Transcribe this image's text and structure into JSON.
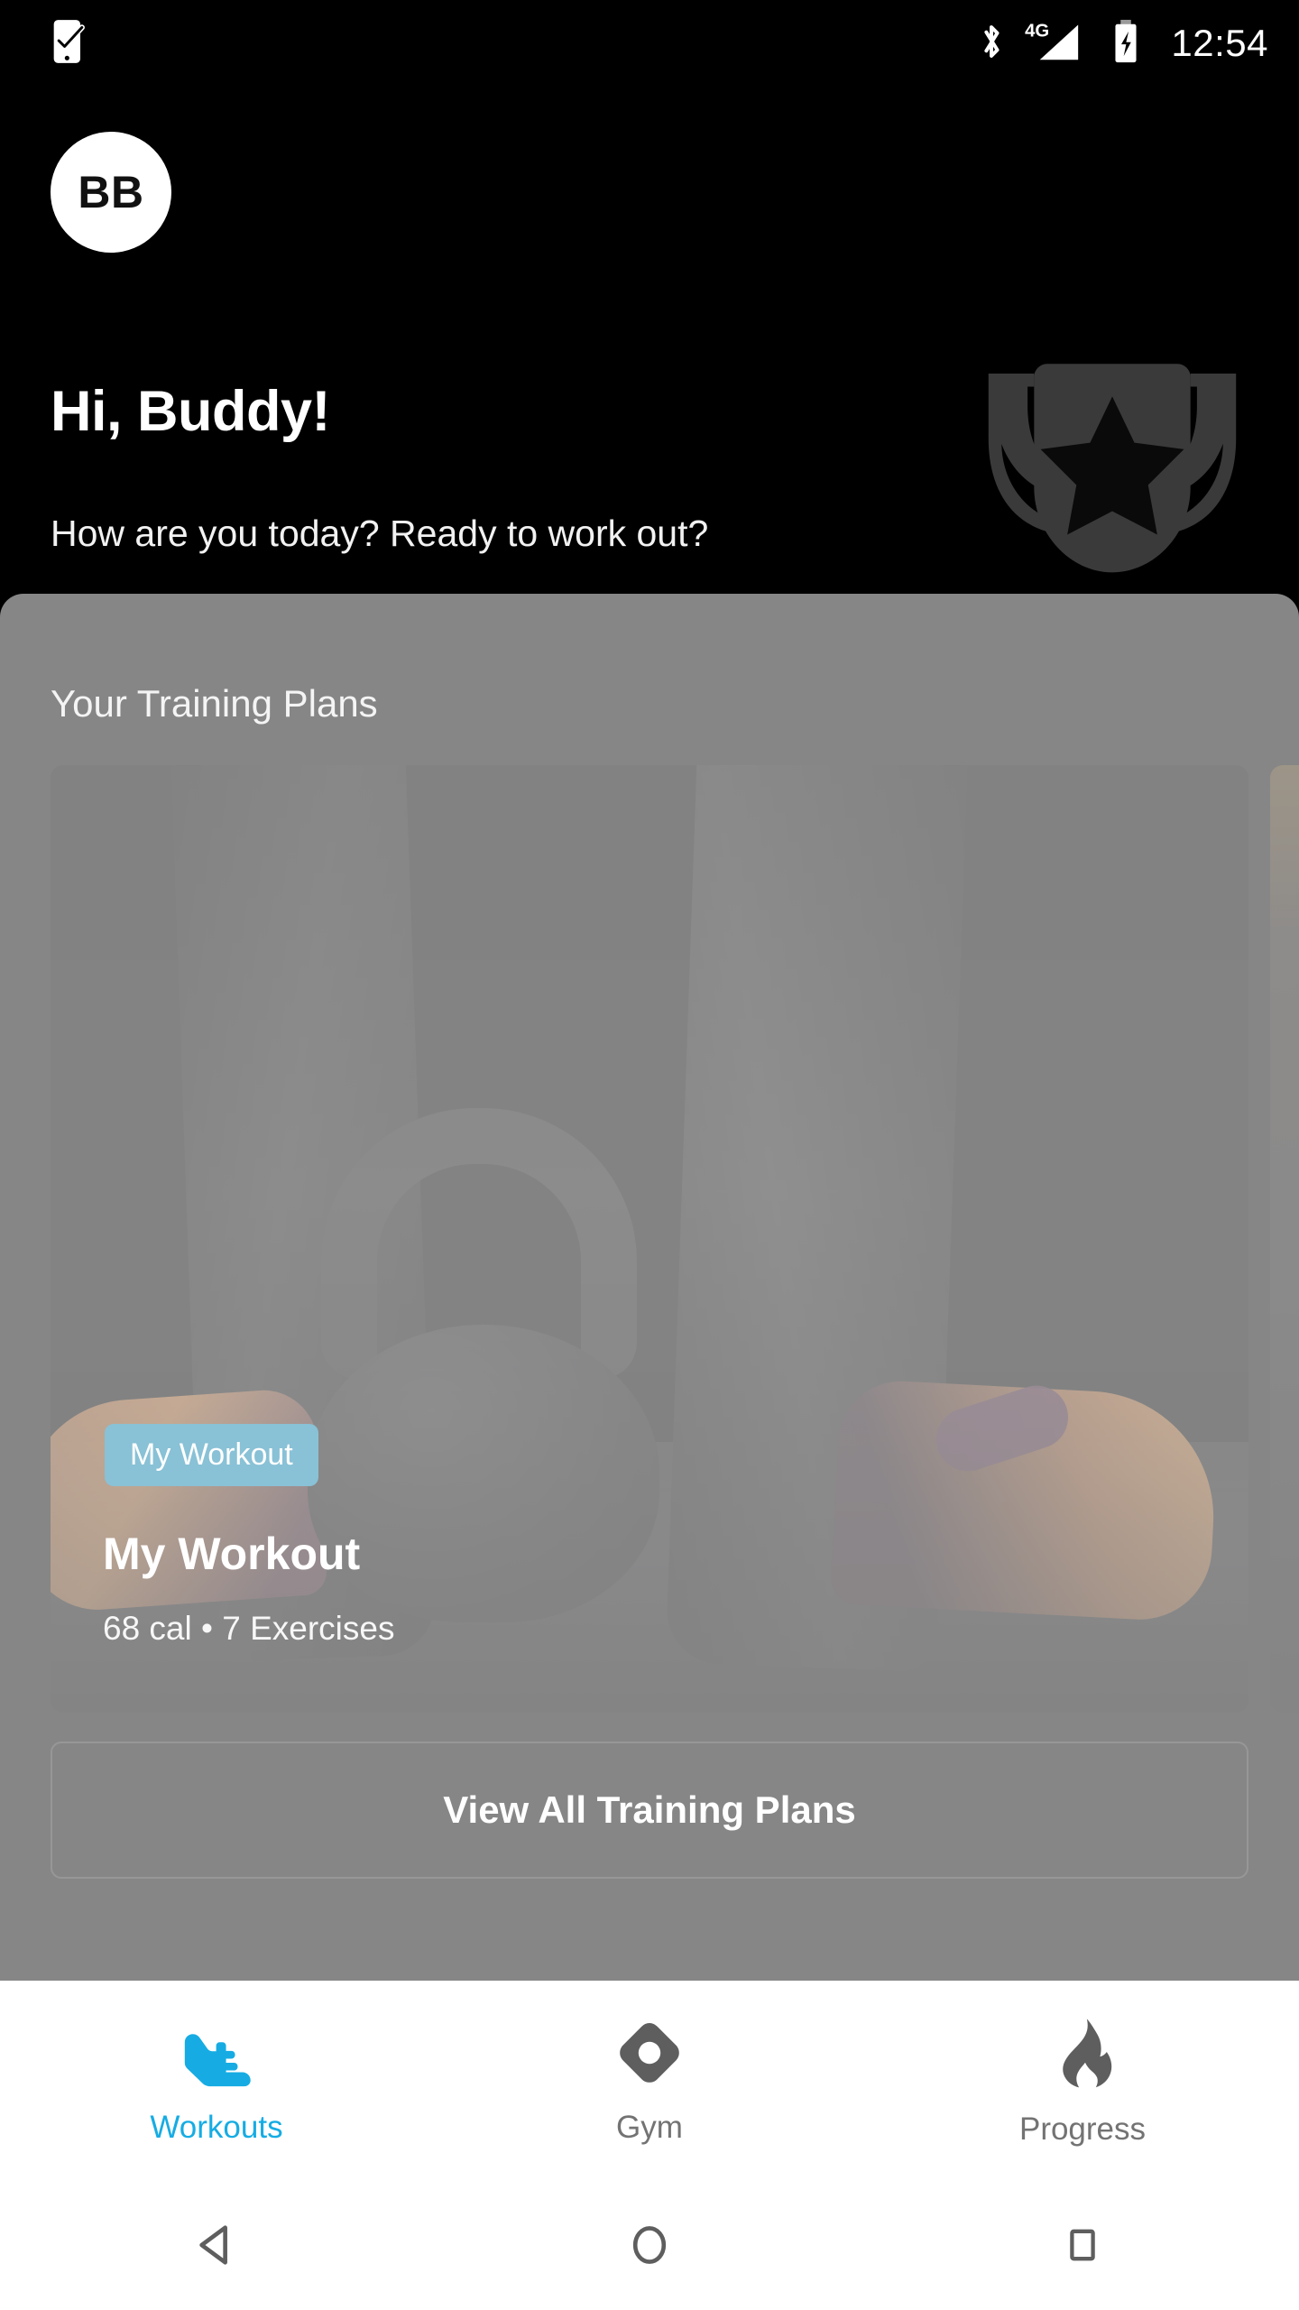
{
  "status_bar": {
    "notification_icon": "phone-check-icon",
    "bluetooth_icon": "bluetooth-icon",
    "network_label": "4G",
    "signal_icon": "signal-bars-icon",
    "battery_icon": "battery-charging-icon",
    "time": "12:54"
  },
  "header": {
    "avatar_initials": "BB",
    "greeting": "Hi, Buddy!",
    "subtitle": "How are you today? Ready to work out?",
    "decoration_icon": "trophy-star-icon"
  },
  "content": {
    "section_title": "Your Training Plans",
    "plans": [
      {
        "badge": "My Workout",
        "title": "My Workout",
        "meta": "68 cal • 7 Exercises",
        "image": "kettlebell-photo"
      },
      {
        "badge": "",
        "title": "",
        "meta": "",
        "image": "gym-photo"
      }
    ],
    "view_all_label": "View All Training Plans"
  },
  "tabbar": {
    "tabs": [
      {
        "label": "Workouts",
        "icon": "running-shoe-icon",
        "active": true
      },
      {
        "label": "Gym",
        "icon": "gym-diamond-icon",
        "active": false
      },
      {
        "label": "Progress",
        "icon": "flame-icon",
        "active": false
      }
    ]
  },
  "navbar": {
    "back": "back-triangle-icon",
    "home": "home-circle-icon",
    "recents": "recents-square-icon"
  },
  "colors": {
    "accent": "#16ace3",
    "badge": "#1283ad",
    "background": "#000000",
    "panel_scrim": "#808080",
    "tab_inactive": "#737373",
    "tabbar_background": "#ffffff"
  }
}
